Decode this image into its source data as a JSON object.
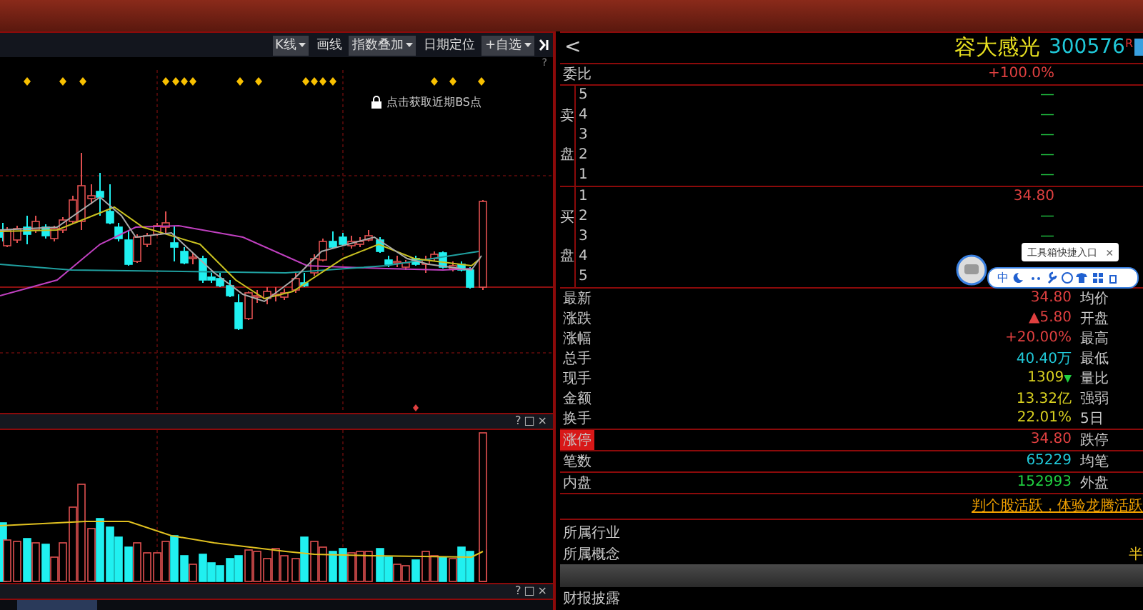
{
  "toolbar": {
    "buttons": [
      {
        "label": "K线",
        "kind": "dropdown"
      },
      {
        "label": "画线",
        "kind": "plain"
      },
      {
        "label": "指数叠加",
        "kind": "dropdown"
      },
      {
        "label": "日期定位",
        "kind": "plain"
      },
      {
        "label": "+自选",
        "kind": "dropdown"
      }
    ],
    "help": "?"
  },
  "chart": {
    "bs_hint": "点击获取近期BS点"
  },
  "panel_controls": [
    "?",
    "□",
    "×"
  ],
  "quote": {
    "back": "<",
    "name": "容大感光",
    "code": "300576",
    "badge": "R",
    "weibi": {
      "label": "委比",
      "value": "+100.0%",
      "color": "#e04040"
    },
    "sell": {
      "side": [
        "卖",
        "盘"
      ],
      "levels": [
        {
          "level": "5",
          "price": "—",
          "color": "#20c040"
        },
        {
          "level": "4",
          "price": "—",
          "color": "#20c040"
        },
        {
          "level": "3",
          "price": "—",
          "color": "#20c040"
        },
        {
          "level": "2",
          "price": "—",
          "color": "#20c040"
        },
        {
          "level": "1",
          "price": "—",
          "color": "#20c040"
        }
      ]
    },
    "buy": {
      "side": [
        "买",
        "盘"
      ],
      "levels": [
        {
          "level": "1",
          "price": "34.80",
          "color": "#e04040"
        },
        {
          "level": "2",
          "price": "—",
          "color": "#20c040"
        },
        {
          "level": "3",
          "price": "—",
          "color": "#20c040"
        },
        {
          "level": "4"
        },
        {
          "level": "5"
        }
      ]
    },
    "stats": [
      {
        "label": "最新",
        "value": "34.80",
        "color": "#e04040",
        "right_label": "均价"
      },
      {
        "label": "涨跌",
        "value": "▲5.80",
        "color": "#e04040",
        "right_label": "开盘"
      },
      {
        "label": "涨幅",
        "value": "+20.00%",
        "color": "#e04040",
        "right_label": "最高"
      },
      {
        "label": "总手",
        "value": "40.40万",
        "color": "#20c8d8",
        "right_label": "最低"
      },
      {
        "label": "现手",
        "value": "1309",
        "color": "#d8d020",
        "arrow": "▼",
        "right_label": "量比"
      },
      {
        "label": "金额",
        "value": "13.32亿",
        "color": "#d8d020",
        "right_label": "强弱"
      },
      {
        "label": "换手",
        "value": "22.01%",
        "color": "#d8d020",
        "right_label": "5日"
      }
    ],
    "extra": [
      {
        "label": "涨停",
        "value": "34.80",
        "color": "#e04040",
        "right_label": "跌停",
        "highlighted": true
      },
      {
        "label": "笔数",
        "value": "65229",
        "color": "#20c8d8",
        "right_label": "均笔",
        "highlighted": false
      },
      {
        "label": "内盘",
        "value": "152993",
        "color": "#20d040",
        "right_label": "外盘",
        "highlighted": false
      }
    ],
    "promo_link": "判个股活跃，体验龙腾活跃",
    "industry_label": "所属行业",
    "concept_label": "所属概念",
    "concept_value": "半",
    "report_label": "财报披露"
  },
  "toolbox": {
    "tooltip": "工具箱快捷入口",
    "close": "×",
    "ime": "中"
  }
}
